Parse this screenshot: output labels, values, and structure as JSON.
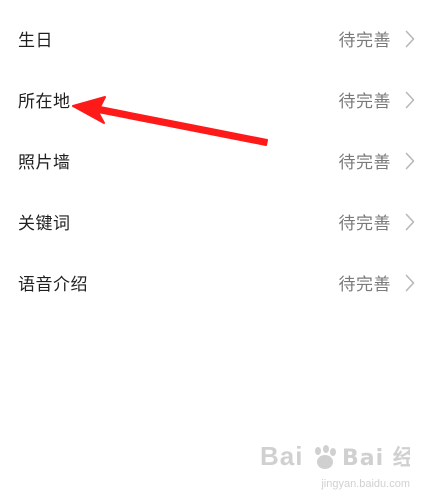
{
  "profile_rows": [
    {
      "label": "生日",
      "value": "待完善"
    },
    {
      "label": "所在地",
      "value": "待完善"
    },
    {
      "label": "照片墙",
      "value": "待完善"
    },
    {
      "label": "关键词",
      "value": "待完善"
    },
    {
      "label": "语音介绍",
      "value": "待完善"
    }
  ],
  "colors": {
    "label": "#1f1f1f",
    "value": "#7a7a7a",
    "chevron": "#b8b8b8",
    "arrow": "#ff1a1a"
  },
  "watermark": {
    "logo_text": "Bai 经验",
    "url": "jingyan.baidu.com"
  }
}
